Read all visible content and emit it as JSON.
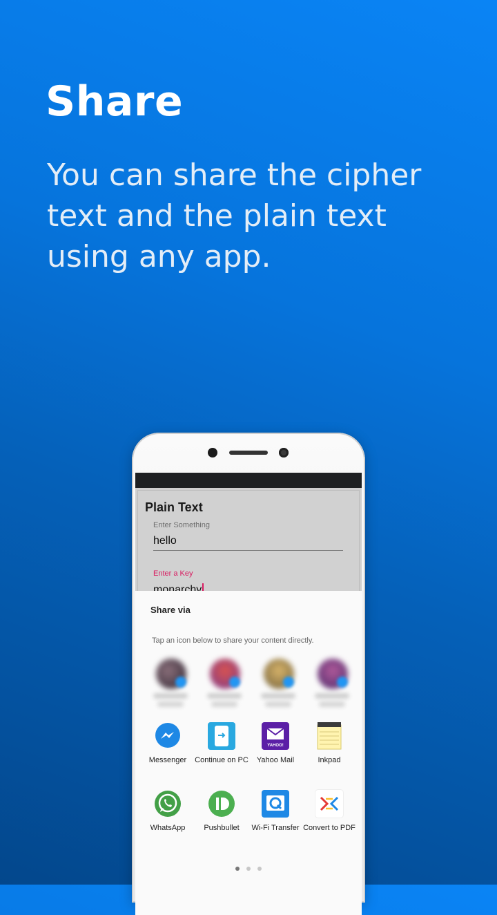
{
  "headline": "Share",
  "subtitle": "You can share the cipher text and the plain text using any app.",
  "app": {
    "card_title": "Plain Text",
    "field1_label": "Enter Something",
    "field1_value": "hello",
    "field2_label": "Enter a Key",
    "field2_value": "monarchy"
  },
  "share": {
    "title": "Share via",
    "hint": "Tap an icon below to share your content directly.",
    "apps": [
      {
        "label": "Messenger",
        "icon": "messenger-icon"
      },
      {
        "label": "Continue on PC",
        "icon": "continue-on-pc-icon"
      },
      {
        "label": "Yahoo Mail",
        "icon": "yahoo-mail-icon"
      },
      {
        "label": "Inkpad",
        "icon": "inkpad-icon"
      },
      {
        "label": "WhatsApp",
        "icon": "whatsapp-icon"
      },
      {
        "label": "Pushbullet",
        "icon": "pushbullet-icon"
      },
      {
        "label": "Wi-Fi Transfer",
        "icon": "wifi-transfer-icon"
      },
      {
        "label": "Convert to PDF",
        "icon": "convert-to-pdf-icon"
      }
    ],
    "yahoo_icon_text": "YAHOO!",
    "page_dots": 3,
    "active_dot": 0
  },
  "colors": {
    "accent_pink": "#d81b60",
    "messenger_blue": "#1e88e5",
    "whatsapp_green": "#43a047",
    "pushbullet_green": "#4caf50",
    "yahoo_purple": "#5b1fa6"
  }
}
